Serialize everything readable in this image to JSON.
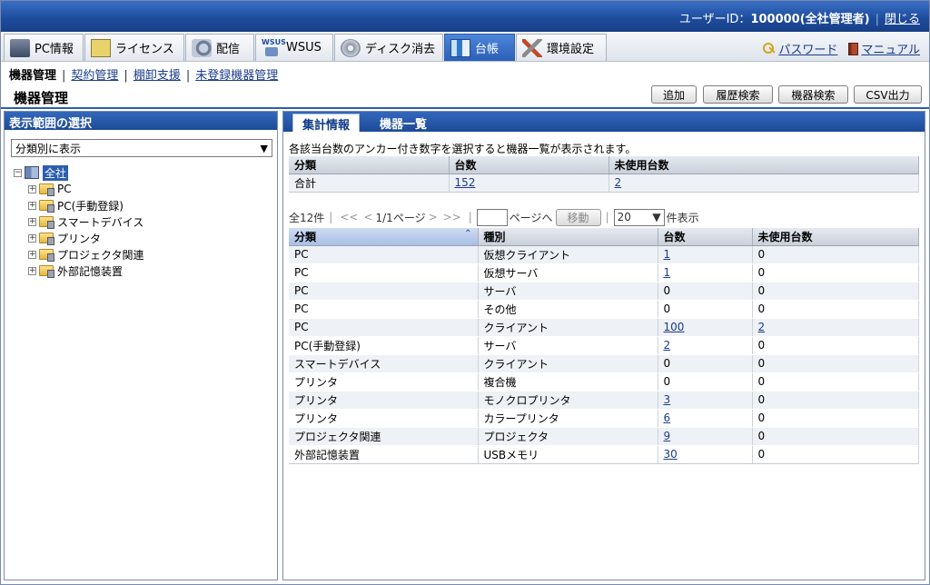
{
  "topbar": {
    "user_label": "ユーザーID：",
    "user_value": "100000(全社管理者)",
    "logout": "閉じる"
  },
  "tabs": [
    {
      "label": "PC情報",
      "icon": "pc-icon"
    },
    {
      "label": "ライセンス",
      "icon": "license-icon"
    },
    {
      "label": "配信",
      "icon": "distribution-icon"
    },
    {
      "label": "WSUS",
      "icon": "wsus-icon"
    },
    {
      "label": "ディスク消去",
      "icon": "disk-erase-icon"
    },
    {
      "label": "台帳",
      "icon": "ledger-icon",
      "active": true
    },
    {
      "label": "環境設定",
      "icon": "tools-icon"
    }
  ],
  "header_links": {
    "password": "パスワード",
    "manual": "マニュアル"
  },
  "subnav": {
    "current": "機器管理",
    "items": [
      "契約管理",
      "棚卸支援",
      "未登録機器管理"
    ]
  },
  "page": {
    "title": "機器管理",
    "buttons": [
      "追加",
      "履歴検索",
      "機器検索",
      "CSV出力"
    ]
  },
  "left_panel": {
    "title": "表示範囲の選択",
    "select_value": "分類別に表示",
    "tree": {
      "root": "全社",
      "children": [
        "PC",
        "PC(手動登録)",
        "スマートデバイス",
        "プリンタ",
        "プロジェクタ関連",
        "外部記憶装置"
      ]
    }
  },
  "right_panel": {
    "tabs": [
      "集計情報",
      "機器一覧"
    ],
    "description": "各該当台数のアンカー付き数字を選択すると機器一覧が表示されます。",
    "summary": {
      "headers": [
        "分類",
        "台数",
        "未使用台数"
      ],
      "row": [
        "合計",
        "152",
        "2"
      ]
    },
    "pager": {
      "total": "全12件",
      "first": "<<",
      "prev": "<",
      "pages": "1/1ページ",
      "next": ">",
      "last": ">>",
      "goto_suffix": "ページへ",
      "move_button": "移動",
      "per_page": "20",
      "per_page_suffix": "件表示"
    },
    "list": {
      "headers": [
        "分類",
        "種別",
        "台数",
        "未使用台数"
      ],
      "rows": [
        [
          "PC",
          "仮想クライアント",
          "1",
          "0"
        ],
        [
          "PC",
          "仮想サーバ",
          "1",
          "0"
        ],
        [
          "PC",
          "サーバ",
          "0",
          "0"
        ],
        [
          "PC",
          "その他",
          "0",
          "0"
        ],
        [
          "PC",
          "クライアント",
          "100",
          "2"
        ],
        [
          "PC(手動登録)",
          "サーバ",
          "2",
          "0"
        ],
        [
          "スマートデバイス",
          "クライアント",
          "0",
          "0"
        ],
        [
          "プリンタ",
          "複合機",
          "0",
          "0"
        ],
        [
          "プリンタ",
          "モノクロプリンタ",
          "3",
          "0"
        ],
        [
          "プリンタ",
          "カラープリンタ",
          "6",
          "0"
        ],
        [
          "プロジェクタ関連",
          "プロジェクタ",
          "9",
          "0"
        ],
        [
          "外部記憶装置",
          "USBメモリ",
          "30",
          "0"
        ]
      ]
    }
  }
}
